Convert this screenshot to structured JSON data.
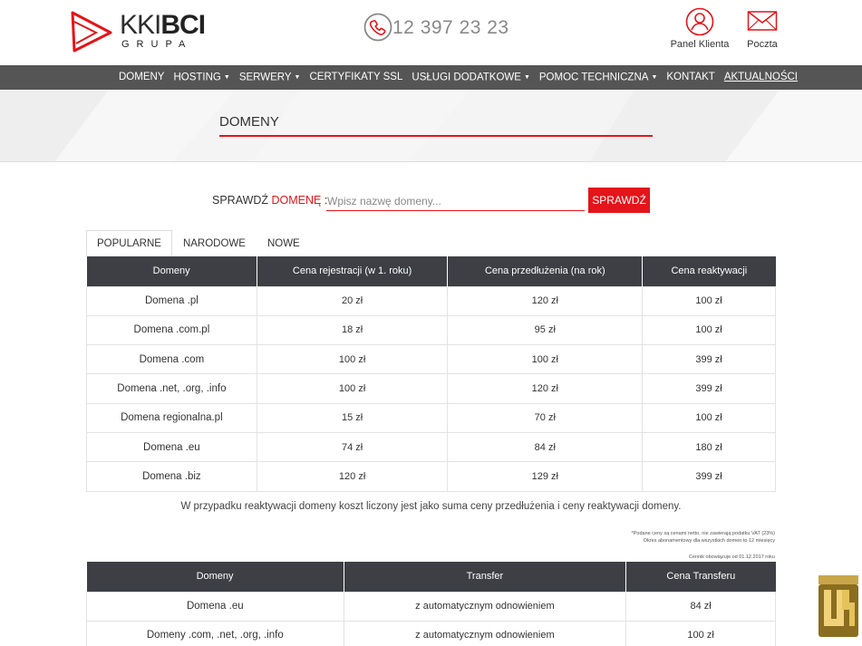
{
  "header": {
    "logo_main_kk": "KKI",
    "logo_main_bci": "BCI",
    "logo_sub": "GRUPA",
    "phone": "12 397 23 23",
    "panel_label": "Panel Klienta",
    "mail_label": "Poczta"
  },
  "nav": {
    "items": [
      {
        "label": "DOMENY",
        "dropdown": false
      },
      {
        "label": "HOSTING",
        "dropdown": true
      },
      {
        "label": "SERWERY",
        "dropdown": true
      },
      {
        "label": "CERTYFIKATY SSL",
        "dropdown": false
      },
      {
        "label": "USŁUGI DODATKOWE",
        "dropdown": true
      },
      {
        "label": "POMOC TECHNICZNA",
        "dropdown": true
      },
      {
        "label": "KONTAKT",
        "dropdown": false
      },
      {
        "label": "AKTUALNOŚCI",
        "dropdown": false
      }
    ]
  },
  "page": {
    "title": "DOMENY"
  },
  "search": {
    "label_prefix": "SPRAWDŹ ",
    "label_red": "DOMENĘ",
    "label_suffix": " :",
    "placeholder": "Wpisz nazwę domeny...",
    "button": "SPRAWDŹ"
  },
  "tabs": [
    "POPULARNE",
    "NARODOWE",
    "NOWE"
  ],
  "table1": {
    "headers": [
      "Domeny",
      "Cena rejestracji (w 1. roku)",
      "Cena przedłużenia (na rok)",
      "Cena reaktywacji"
    ],
    "rows": [
      [
        "Domena .pl",
        "20 zł",
        "120 zł",
        "100 zł"
      ],
      [
        "Domena .com.pl",
        "18 zł",
        "95 zł",
        "100 zł"
      ],
      [
        "Domena .com",
        "100 zł",
        "100 zł",
        "399 zł"
      ],
      [
        "Domena .net, .org, .info",
        "100 zł",
        "120 zł",
        "399 zł"
      ],
      [
        "Domena regionalna.pl",
        "15 zł",
        "70 zł",
        "100 zł"
      ],
      [
        "Domena .eu",
        "74 zł",
        "84 zł",
        "180 zł"
      ],
      [
        "Domena .biz",
        "120 zł",
        "129 zł",
        "399 zł"
      ]
    ]
  },
  "note": "W przypadku reaktywacji domeny koszt liczony jest jako suma ceny przedłużenia i ceny reaktywacji domeny.",
  "fine_print": {
    "line1": "*Podane ceny są cenami netto, nie zawierają podatku VAT (23%)",
    "line2": "Okres abonamentowy dla wszystkich domen to 12 miesięcy",
    "line3": "Cennik obowiązuje od 01.12.2017 roku"
  },
  "table2": {
    "headers": [
      "Domeny",
      "Transfer",
      "Cena Transferu"
    ],
    "rows": [
      [
        "Domena .eu",
        "z automatycznym odnowieniem",
        "84 zł"
      ],
      [
        "Domeny .com, .net, .org, .info",
        "z automatycznym odnowieniem",
        "100 zł"
      ]
    ]
  },
  "watermark": {
    "text": "WHTOP.com"
  },
  "colors": {
    "accent": "#e3151a",
    "nav_bg": "#555555",
    "table_header_bg": "#3d3f45"
  }
}
